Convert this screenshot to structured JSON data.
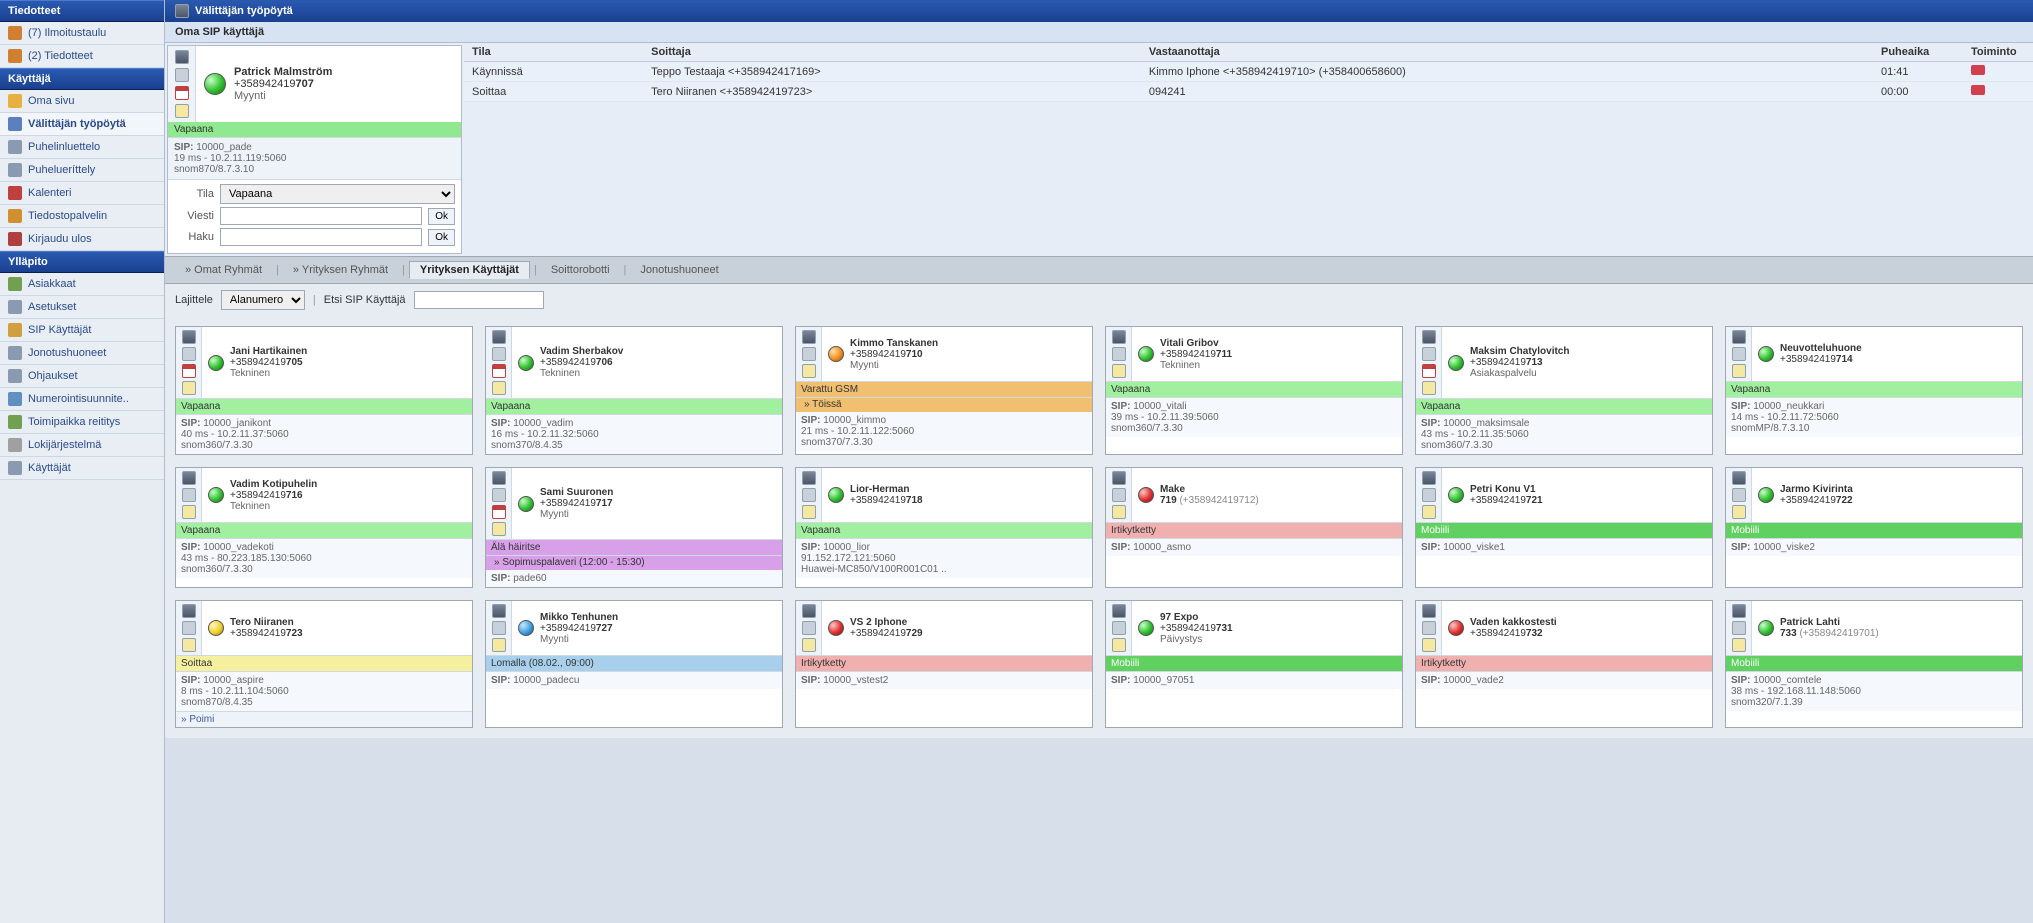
{
  "sidebar": {
    "sections": [
      {
        "title": "Tiedotteet",
        "items": [
          {
            "label": "(7) Ilmoitustaulu",
            "icon": "#d08030"
          },
          {
            "label": "(2) Tiedotteet",
            "icon": "#d08030"
          }
        ]
      },
      {
        "title": "Käyttäjä",
        "items": [
          {
            "label": "Oma sivu",
            "icon": "#e8b040"
          },
          {
            "label": "Välittäjän työpöytä",
            "icon": "#5a80c0",
            "active": true
          },
          {
            "label": "Puhelinluettelo",
            "icon": "#8a9ab0"
          },
          {
            "label": "Puhelueríttely",
            "icon": "#8a9ab0"
          },
          {
            "label": "Kalenteri",
            "icon": "#c04040"
          },
          {
            "label": "Tiedostopalvelin",
            "icon": "#d09030"
          },
          {
            "label": "Kirjaudu ulos",
            "icon": "#b04040"
          }
        ]
      },
      {
        "title": "Ylläpito",
        "items": [
          {
            "label": "Asiakkaat",
            "icon": "#70a050"
          },
          {
            "label": "Asetukset",
            "icon": "#8a9ab0"
          },
          {
            "label": "SIP Käyttäjät",
            "icon": "#d0a040"
          },
          {
            "label": "Jonotushuoneet",
            "icon": "#8a9ab0"
          },
          {
            "label": "Ohjaukset",
            "icon": "#8a9ab0"
          },
          {
            "label": "Numerointisuunnite..",
            "icon": "#6090c0"
          },
          {
            "label": "Toimipaikka reititys",
            "icon": "#70a050"
          },
          {
            "label": "Lokijärjestelmä",
            "icon": "#a0a0a0"
          },
          {
            "label": "Käyttäjät",
            "icon": "#8a9ab0"
          }
        ]
      }
    ]
  },
  "header": {
    "title": "Välittäjän työpöytä",
    "subtitle": "Oma SIP käyttäjä"
  },
  "own": {
    "name": "Patrick Malmström",
    "num_prefix": "+358942419",
    "ext": "707",
    "dept": "Myynti",
    "status": "Vapaana",
    "sip_label": "SIP:",
    "sip_user": "10000_pade",
    "sip_line1": "19 ms - 10.2.11.119:5060",
    "sip_line2": "snom870/8.7.3.10",
    "form": {
      "tila_label": "Tila",
      "tila_value": "Vapaana",
      "viesti_label": "Viesti",
      "ok": "Ok",
      "haku_label": "Haku"
    }
  },
  "calls": {
    "headers": {
      "tila": "Tila",
      "soittaja": "Soittaja",
      "vastaanottaja": "Vastaanottaja",
      "puheaika": "Puheaika",
      "toiminto": "Toiminto"
    },
    "rows": [
      {
        "tila": "Käynnissä",
        "soittaja": "Teppo Testaaja <+358942417169>",
        "vastaanottaja": "Kimmo Iphone <+358942419710> (+358400658600)",
        "puheaika": "01:41"
      },
      {
        "tila": "Soittaa",
        "soittaja": "Tero Niiranen <+358942419723>",
        "vastaanottaja": "094241",
        "puheaika": "00:00"
      }
    ]
  },
  "tabs": {
    "items": [
      "» Omat Ryhmät",
      "» Yrityksen Ryhmät",
      "Yrityksen Käyttäjät",
      "Soittorobotti",
      "Jonotushuoneet"
    ],
    "active": 2
  },
  "filter": {
    "lajittele_label": "Lajittele",
    "lajittele_value": "Alanumero",
    "etsi_label": "Etsi SIP Käyttäjä"
  },
  "users": [
    {
      "name": "Jani Hartikainen",
      "prefix": "+358942419",
      "ext": "705",
      "dept": "Tekninen",
      "orb": "green",
      "status": "Vapaana",
      "status_cls": "status-green",
      "sip": "10000_janikont",
      "l1": "40 ms - 10.2.11.37:5060",
      "l2": "snom360/7.3.30",
      "show_cal": true
    },
    {
      "name": "Vadim Sherbakov",
      "prefix": "+358942419",
      "ext": "706",
      "dept": "Tekninen",
      "orb": "green",
      "status": "Vapaana",
      "status_cls": "status-green",
      "sip": "10000_vadim",
      "l1": "16 ms - 10.2.11.32:5060",
      "l2": "snom370/8.4.35",
      "show_cal": true
    },
    {
      "name": "Kimmo Tanskanen",
      "prefix": "+358942419",
      "ext": "710",
      "dept": "Myynti",
      "orb": "orange",
      "status": "Varattu GSM",
      "status_cls": "status-orange",
      "status2": "» Töissä",
      "status2_cls": "status-orange",
      "sip": "10000_kimmo",
      "l1": "21 ms - 10.2.11.122:5060",
      "l2": "snom370/7.3.30"
    },
    {
      "name": "Vitali Gribov",
      "prefix": "+358942419",
      "ext": "711",
      "dept": "Tekninen",
      "orb": "green",
      "status": "Vapaana",
      "status_cls": "status-green",
      "sip": "10000_vitali",
      "l1": "39 ms - 10.2.11.39:5060",
      "l2": "snom360/7.3.30"
    },
    {
      "name": "Maksim Chatylovitch",
      "prefix": "+358942419",
      "ext": "713",
      "dept": "Asiakaspalvelu",
      "orb": "green",
      "status": "Vapaana",
      "status_cls": "status-green",
      "sip": "10000_maksimsale",
      "l1": "43 ms - 10.2.11.35:5060",
      "l2": "snom360/7.3.30",
      "show_cal": true
    },
    {
      "name": "Neuvotteluhuone",
      "prefix": "+358942419",
      "ext": "714",
      "dept": "",
      "orb": "green",
      "status": "Vapaana",
      "status_cls": "status-green",
      "sip": "10000_neukkari",
      "l1": "14 ms - 10.2.11.72:5060",
      "l2": "snomMP/8.7.3.10"
    },
    {
      "name": "Vadim Kotipuhelin",
      "prefix": "+358942419",
      "ext": "716",
      "dept": "Tekninen",
      "orb": "green",
      "status": "Vapaana",
      "status_cls": "status-green",
      "sip": "10000_vadekoti",
      "l1": "43 ms - 80.223.185.130:5060",
      "l2": "snom360/7.3.30"
    },
    {
      "name": "Sami Suuronen",
      "prefix": "+358942419",
      "ext": "717",
      "dept": "Myynti",
      "orb": "green",
      "status": "Älä häiritse",
      "status_cls": "status-purple",
      "status2": "» Sopimuspalaveri (12:00 - 15:30)",
      "status2_cls": "status-purple",
      "sip": "pade60",
      "show_cal": true
    },
    {
      "name": "Lior-Herman",
      "prefix": "+358942419",
      "ext": "718",
      "dept": "",
      "orb": "green",
      "status": "Vapaana",
      "status_cls": "status-green",
      "sip": "10000_lior",
      "l1": "91.152.172.121:5060",
      "l2": "Huawei-MC850/V100R001C01 .."
    },
    {
      "name": "Make",
      "prefix_only": "719",
      "note": "(+358942419712)",
      "dept": "",
      "orb": "red",
      "status": "Irtikytketty",
      "status_cls": "status-red",
      "sip": "10000_asmo"
    },
    {
      "name": "Petri Konu V1",
      "prefix": "+358942419",
      "ext": "721",
      "dept": "",
      "orb": "green",
      "status": "Mobiili",
      "status_cls": "status-green2",
      "sip": "10000_viske1"
    },
    {
      "name": "Jarmo Kivirinta",
      "prefix": "+358942419",
      "ext": "722",
      "dept": "",
      "orb": "green",
      "status": "Mobiili",
      "status_cls": "status-green2",
      "sip": "10000_viske2"
    },
    {
      "name": "Tero Niiranen",
      "prefix": "+358942419",
      "ext": "723",
      "dept": "",
      "orb": "yellow",
      "status": "Soittaa",
      "status_cls": "status-yellow",
      "sip": "10000_aspire",
      "l1": "8 ms - 10.2.11.104:5060",
      "l2": "snom870/8.4.35",
      "poimi": "» Poimi"
    },
    {
      "name": "Mikko Tenhunen",
      "prefix": "+358942419",
      "ext": "727",
      "dept": "Myynti",
      "orb": "blue",
      "status": "Lomalla (08.02., 09:00)",
      "status_cls": "status-blue",
      "sip": "10000_padecu"
    },
    {
      "name": "VS 2 Iphone",
      "prefix": "+358942419",
      "ext": "729",
      "dept": "",
      "orb": "red",
      "status": "Irtikytketty",
      "status_cls": "status-red",
      "sip": "10000_vstest2"
    },
    {
      "name": "97 Expo",
      "prefix": "+358942419",
      "ext": "731",
      "dept": "Päivystys",
      "orb": "green",
      "status": "Mobiili",
      "status_cls": "status-green2",
      "sip": "10000_97051"
    },
    {
      "name": "Vaden kakkostesti",
      "prefix": "+358942419",
      "ext": "732",
      "dept": "",
      "orb": "red",
      "status": "Irtikytketty",
      "status_cls": "status-red",
      "sip": "10000_vade2"
    },
    {
      "name": "Patrick Lahti",
      "prefix_only": "733",
      "note": "(+358942419701)",
      "dept": "",
      "orb": "green",
      "status": "Mobiili",
      "status_cls": "status-green2",
      "sip": "10000_comtele",
      "l1": "38 ms - 192.168.11.148:5060",
      "l2": "snom320/7.1.39"
    }
  ],
  "labels": {
    "sip": "SIP:"
  }
}
